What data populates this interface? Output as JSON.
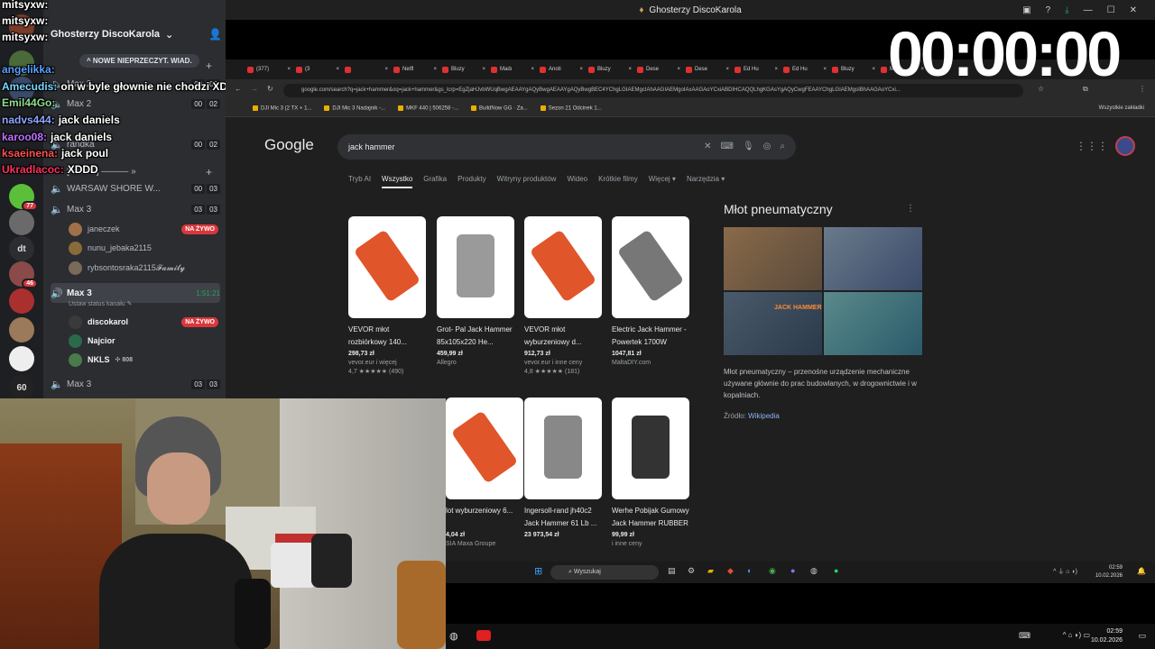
{
  "window": {
    "title": "Ghosterzy DiscoKarola"
  },
  "timer": "00:00:00",
  "discord": {
    "server_name": "Ghosterzy DiscoKarola",
    "new_unread": "NOWE NIEPRZECZYT. WIAD.",
    "servers": [
      {
        "label": "",
        "color": "#7a3b2a"
      },
      {
        "label": "",
        "color": "#4a6a3a"
      },
      {
        "label": "",
        "color": "#3a4a6a"
      },
      {
        "label": "77",
        "color": "#5bbf3a",
        "badge": "77"
      },
      {
        "label": "",
        "color": "#6a6a6a"
      },
      {
        "label": "dt",
        "color": "#2b2d31"
      },
      {
        "label": "46",
        "color": "#8a4a4a",
        "badge": "46"
      },
      {
        "label": "",
        "color": "#aa3030"
      },
      {
        "label": "",
        "color": "#9a7a5a"
      },
      {
        "label": "",
        "color": "#eeeeee"
      },
      {
        "label": "60",
        "color": "#222222"
      }
    ],
    "channels": [
      {
        "name": "Max 2",
        "counts": [
          "00",
          "02"
        ]
      },
      {
        "name": "Max 2",
        "counts": [
          "00",
          "02"
        ]
      },
      {
        "name": "randka",
        "counts": [
          "00",
          "02"
        ]
      },
      {
        "name": "[MAX 3] ——— »",
        "counts": []
      },
      {
        "name": "WARSAW SHORE W...",
        "counts": [
          "00",
          "03"
        ]
      },
      {
        "name": "Max 3",
        "counts": [
          "03",
          "03"
        ]
      }
    ],
    "users_a": [
      {
        "name": "janeczek",
        "live": "NA ŻYWO"
      },
      {
        "name": "nunu_jebaka2115",
        "live": ""
      },
      {
        "name": "rybsontosraka2115𝓕𝓪𝓶𝓲𝓵𝔂",
        "live": ""
      }
    ],
    "active_channel": {
      "name": "Max 3",
      "timer": "1:51:21",
      "status_hint": "Ustaw status kanału"
    },
    "users_b": [
      {
        "name": "discokarol",
        "live": "NA ŻYWO"
      },
      {
        "name": "Najcior",
        "live": ""
      },
      {
        "name": "NKLS",
        "extra": "808"
      }
    ],
    "last_channel": {
      "name": "Max 3",
      "counts": [
        "03",
        "03"
      ]
    }
  },
  "chat": [
    {
      "name": "mitsyxw:",
      "msg": "",
      "color": "#ffffff"
    },
    {
      "name": "mitsyxw:",
      "msg": "",
      "color": "#ffffff"
    },
    {
      "name": "mitsyxw:",
      "msg": "",
      "color": "#ffffff"
    },
    {
      "name": "angelikka:",
      "msg": "",
      "color": "#5aa0ff"
    },
    {
      "name": "Amecudis:",
      "msg": "on w byle głownie nie chodzi XDD",
      "color": "#7ad6ff"
    },
    {
      "name": "Emil44Go:",
      "msg": "",
      "color": "#8fe08f"
    },
    {
      "name": "nadvs444:",
      "msg": "jack daniels",
      "color": "#8fa8ff"
    },
    {
      "name": "karoo08:",
      "msg": "jack daniels",
      "color": "#c070ff"
    },
    {
      "name": "ksaeinena:",
      "msg": "jack poul",
      "color": "#ff5050"
    },
    {
      "name": "Ukradlacoc:",
      "msg": "XDDD",
      "color": "#ff3060"
    }
  ],
  "browser": {
    "tabs": [
      "(377)",
      "(3",
      "",
      "Netfl",
      "Bluzy",
      "Madı",
      "Anoti",
      "Bluzy",
      "Dese",
      "Dese",
      "Ed Hu",
      "Ed Hu",
      "Bluzy",
      "Męsk"
    ],
    "url": "google.com/search?q=jack+hammer&oq=jack+hammer&gs_lcrp=EgZjaHJvbWUqBwgAEAAYgAQyBwgAEAAYgAQyBwgBEC4YChgLGIAEMgcIAhAAGIAEMgoIAxAAGAoYCxiABDIHCAQQLhgKGAsYgAQyCwgFEAAYChgLGIAEMgsIBhAAGAoYCxi...",
    "bookmarks": [
      "DJI Mic 3 (2 TX + 1...",
      "DJI Mic 3 Nadajnik -...",
      "MKF 440 | 506258 -...",
      "BuildNow GG · Za...",
      "Sezon 21 Odcinek 1..."
    ],
    "bookmarks_right": "Wszystkie zakładki"
  },
  "google": {
    "logo": "Google",
    "query": "jack hammer",
    "tabs": [
      "Tryb AI",
      "Wszystko",
      "Grafika",
      "Produkty",
      "Witryny produktów",
      "Wideo",
      "Krótkie filmy",
      "Więcej ▾",
      "Narzędzia ▾"
    ],
    "active_tab": 1,
    "products": [
      {
        "title": "VEVOR młot rozbiórkowy 140...",
        "price": "298,73 zł",
        "store": "vevor.eur i więcej",
        "rating": "4,7 ★★★★★ (490)"
      },
      {
        "title": "Grot- Pal Jack Hammer 85x105x220 He...",
        "price": "459,99 zł",
        "store": "Allegro",
        "rating": ""
      },
      {
        "title": "VEVOR młot wyburzeniowy d...",
        "price": "912,73 zł",
        "store": "vevor.eur i inne ceny",
        "rating": "4,8 ★★★★★ (181)"
      },
      {
        "title": "Electric Jack Hammer - Powertek 1700W",
        "price": "1047,81 zł",
        "store": "MaltaDIY.com",
        "rating": ""
      },
      {
        "title": "lot wyburzeniowy 6...",
        "price": "4,04 zł",
        "store": "SIA Maxa Groupe",
        "rating": ""
      },
      {
        "title": "Ingersoll-rand jh40c2 Jack Hammer 61 Lb ...",
        "price": "23 973,54 zł",
        "store": "",
        "rating": ""
      },
      {
        "title": "Werhe Pobijak Gumowy Jack Hammer RUBBER",
        "price": "99,99 zł",
        "store": "i inne ceny",
        "rating": ""
      }
    ],
    "knowledge": {
      "title": "Młot pneumatyczny",
      "image_text": "JACK HAMMER",
      "description": "Młot pneumatyczny – przenośne urządzenie mechaniczne używane głównie do prac budowlanych, w drogownictwie i w kopalniach.",
      "source_label": "Źródło:",
      "source_link": "Wikipedia"
    }
  },
  "taskbar_inner": {
    "search": "Wyszukaj",
    "time": "02:59",
    "date": "10.02.2026"
  },
  "taskbar_outer": {
    "time": "02:59",
    "date": "10.02.2026"
  }
}
